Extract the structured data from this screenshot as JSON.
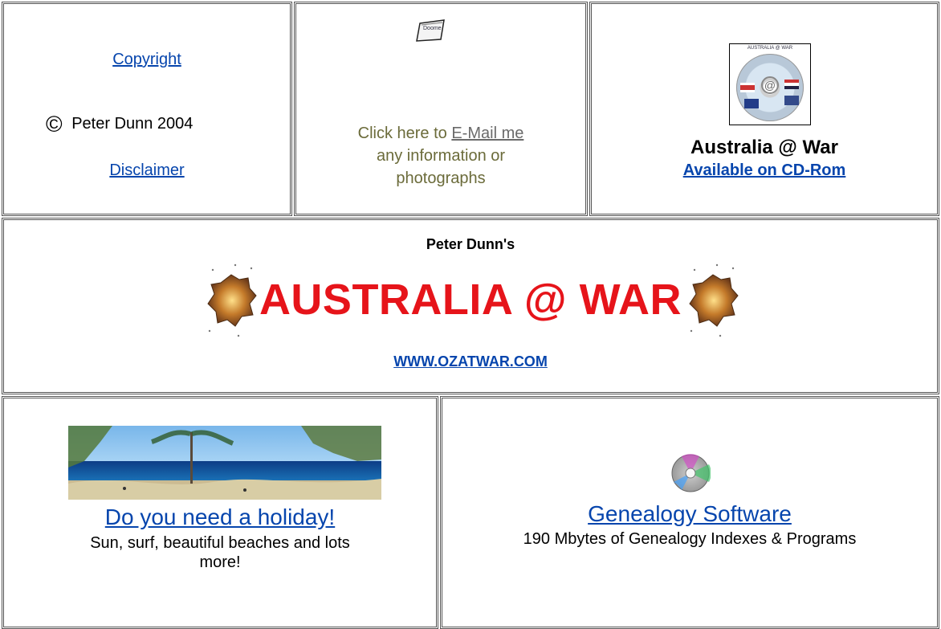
{
  "top": {
    "copyright_label": "Copyright",
    "copyright_owner": "Peter Dunn 2004",
    "disclaimer_label": "Disclaimer",
    "email_prefix": "Click here to ",
    "email_link": "E-Mail me",
    "email_line2": "any information or",
    "email_line3": "photographs",
    "cd_title": "Australia @ War",
    "cd_link": "Available on CD-Rom",
    "cd_image_text": "AUSTRALIA @ WAR"
  },
  "banner": {
    "author": "Peter Dunn's",
    "title": "AUSTRALIA @ WAR",
    "url": "WWW.OZATWAR.COM"
  },
  "bottom": {
    "holiday_link": "Do you need a holiday!",
    "holiday_line1": "Sun, surf, beautiful beaches and lots",
    "holiday_line2": "more!",
    "genealogy_link": "Genealogy Software",
    "genealogy_desc": "190 Mbytes of Genealogy Indexes & Programs"
  },
  "colors": {
    "link": "#0645ad",
    "title_red": "#e6141a",
    "muted_olive": "#6b6b3a"
  }
}
